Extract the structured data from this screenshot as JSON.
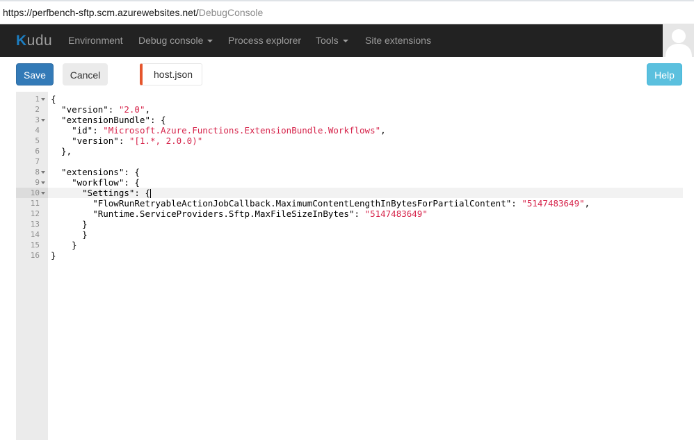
{
  "browser": {
    "url_host": "https://perfbench-sftp.scm.azurewebsites.net/",
    "url_path": "DebugConsole"
  },
  "navbar": {
    "brand": "udu",
    "brand_mark": "K",
    "items": [
      {
        "label": "Environment"
      },
      {
        "label": "Debug console",
        "dropdown": true
      },
      {
        "label": "Process explorer"
      },
      {
        "label": "Tools",
        "dropdown": true
      },
      {
        "label": "Site extensions"
      }
    ]
  },
  "toolbar": {
    "save_label": "Save",
    "cancel_label": "Cancel",
    "file_name": "host.json",
    "help_label": "Help"
  },
  "editor": {
    "active_line": 10,
    "folded_lines": [
      1,
      3,
      8,
      9,
      10
    ],
    "lines": [
      [
        {
          "t": "{"
        }
      ],
      [
        {
          "t": "  \"version\": "
        },
        {
          "t": "\"2.0\"",
          "s": 1
        },
        {
          "t": ","
        }
      ],
      [
        {
          "t": "  \"extensionBundle\": {"
        }
      ],
      [
        {
          "t": "    \"id\": "
        },
        {
          "t": "\"Microsoft.Azure.Functions.ExtensionBundle.Workflows\"",
          "s": 1
        },
        {
          "t": ","
        }
      ],
      [
        {
          "t": "    \"version\": "
        },
        {
          "t": "\"[1.*, 2.0.0)\"",
          "s": 1
        }
      ],
      [
        {
          "t": "  },"
        }
      ],
      [
        {
          "t": ""
        }
      ],
      [
        {
          "t": "  \"extensions\": {"
        }
      ],
      [
        {
          "t": "    \"workflow\": {"
        }
      ],
      [
        {
          "t": "      \"Settings\": {"
        }
      ],
      [
        {
          "t": "        \"FlowRunRetryableActionJobCallback.MaximumContentLengthInBytesForPartialContent\": "
        },
        {
          "t": "\"5147483649\"",
          "s": 1
        },
        {
          "t": ","
        }
      ],
      [
        {
          "t": "        \"Runtime.ServiceProviders.Sftp.MaxFileSizeInBytes\": "
        },
        {
          "t": "\"5147483649\"",
          "s": 1
        }
      ],
      [
        {
          "t": "      }"
        }
      ],
      [
        {
          "t": "      }"
        }
      ],
      [
        {
          "t": "    }"
        }
      ],
      [
        {
          "t": "}"
        }
      ]
    ]
  },
  "colors": {
    "navbar_bg": "#222222",
    "save_btn": "#337ab7",
    "help_btn": "#5bc0de",
    "string": "#d6234a",
    "tab_accent": "#e5552c"
  }
}
